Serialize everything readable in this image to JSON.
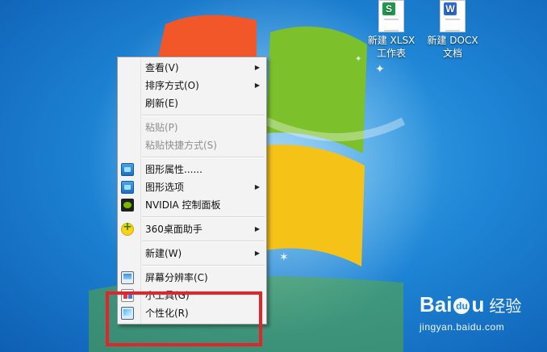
{
  "desktop": {
    "icons": [
      {
        "label_line1": "新建 XLSX",
        "label_line2": "工作表",
        "badge": "S"
      },
      {
        "label_line1": "新建 DOCX",
        "label_line2": "文档",
        "badge": "W"
      }
    ]
  },
  "context_menu": {
    "items": [
      {
        "label": "查看(V)",
        "submenu": true,
        "disabled": false,
        "icon": ""
      },
      {
        "label": "排序方式(O)",
        "submenu": true,
        "disabled": false,
        "icon": ""
      },
      {
        "label": "刷新(E)",
        "submenu": false,
        "disabled": false,
        "icon": ""
      },
      {
        "label": "粘贴(P)",
        "submenu": false,
        "disabled": true,
        "icon": ""
      },
      {
        "label": "粘贴快捷方式(S)",
        "submenu": false,
        "disabled": true,
        "icon": ""
      },
      {
        "label": "图形属性......",
        "submenu": false,
        "disabled": false,
        "icon": "intel-graphics-icon"
      },
      {
        "label": "图形选项",
        "submenu": true,
        "disabled": false,
        "icon": "intel-graphics-icon"
      },
      {
        "label": "NVIDIA 控制面板",
        "submenu": false,
        "disabled": false,
        "icon": "nvidia-icon"
      },
      {
        "label": "360桌面助手",
        "submenu": true,
        "disabled": false,
        "icon": "360-icon"
      },
      {
        "label": "新建(W)",
        "submenu": true,
        "disabled": false,
        "icon": ""
      },
      {
        "label": "屏幕分辨率(C)",
        "submenu": false,
        "disabled": false,
        "icon": "screen-resolution-icon"
      },
      {
        "label": "小工具(G)",
        "submenu": false,
        "disabled": false,
        "icon": "gadgets-icon"
      },
      {
        "label": "个性化(R)",
        "submenu": false,
        "disabled": false,
        "icon": "personalize-icon"
      }
    ],
    "submenu_arrow": "▶"
  },
  "watermark": {
    "brand": "Bai",
    "brand_tail": "u",
    "paw": "du",
    "cn": "经验",
    "url": "jingyan.baidu.com"
  },
  "colors": {
    "highlight": "#e3242b",
    "menu_bg": "#f3f3f3",
    "desktop_blue": "#1f86d6"
  }
}
